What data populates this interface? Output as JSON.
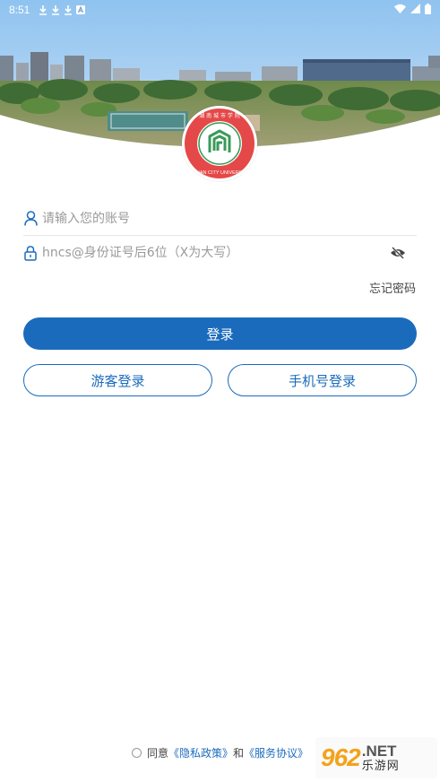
{
  "status_bar": {
    "time": "8:51",
    "icons_left": [
      "download-icon",
      "download-icon",
      "download-icon",
      "app-icon"
    ],
    "icons_right": [
      "wifi-icon",
      "signal-icon",
      "battery-icon"
    ]
  },
  "hero": {
    "description_icon": "campus-photo"
  },
  "logo": {
    "name": "university-logo"
  },
  "form": {
    "account_placeholder": "请输入您的账号",
    "password_placeholder": "hncs@身份证号后6位（X为大写）",
    "forgot_label": "忘记密码"
  },
  "buttons": {
    "login_label": "登录",
    "guest_label": "游客登录",
    "phone_label": "手机号登录"
  },
  "agreement": {
    "prefix": "同意",
    "privacy_label": "《隐私政策》",
    "and": "和",
    "service_label": "《服务协议》"
  },
  "watermark": {
    "number": "962",
    "net": ".NET",
    "cn": "乐游网"
  },
  "colors": {
    "primary": "#1b6bbd",
    "logo_red": "#e54848"
  }
}
